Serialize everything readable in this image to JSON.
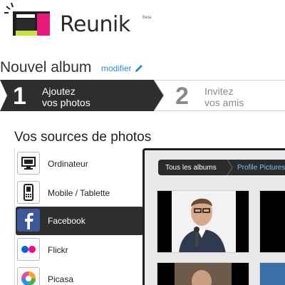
{
  "app": {
    "logo_text": "Reunik",
    "logo_badge": "Beta"
  },
  "album": {
    "title": "Nouvel album",
    "modify_link": "modifier"
  },
  "steps": [
    {
      "number": "1",
      "line1": "Ajoutez",
      "line2": "vos photos",
      "state": "active"
    },
    {
      "number": "2",
      "line1": "Invitez",
      "line2": "vos amis",
      "state": "inactive"
    }
  ],
  "sources": {
    "title": "Vos sources de photos",
    "items": [
      {
        "label": "Ordinateur",
        "icon": "monitor-icon"
      },
      {
        "label": "Mobile / Tablette",
        "icon": "mobile-icon"
      },
      {
        "label": "Facebook",
        "icon": "facebook-icon",
        "selected": true
      },
      {
        "label": "Flickr",
        "icon": "flickr-icon"
      },
      {
        "label": "Picasa",
        "icon": "picasa-icon"
      }
    ]
  },
  "browser": {
    "breadcrumb_all": "Tous les albums",
    "breadcrumb_current": "Profile Pictures"
  },
  "colors": {
    "accent_link": "#2a8fc7",
    "active_dark": "#2e2e2e",
    "facebook_blue": "#3b5998",
    "flickr_pink": "#ff0084",
    "flickr_blue": "#0063dc"
  }
}
